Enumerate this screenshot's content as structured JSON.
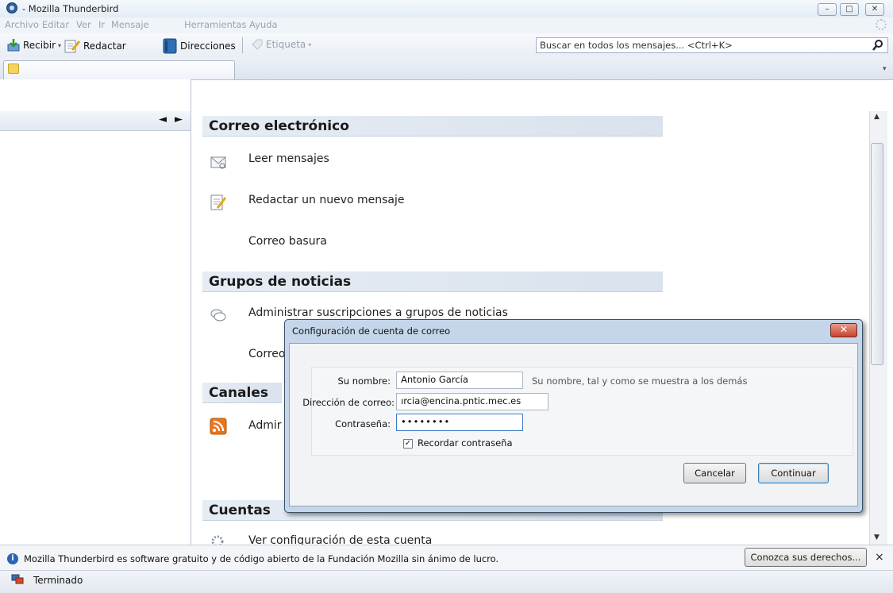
{
  "window": {
    "title": "- Mozilla Thunderbird"
  },
  "menu": {
    "items": [
      "Archivo",
      "Editar",
      "Ver",
      "Ir",
      "Mensaje",
      "Herramientas",
      "Ayuda"
    ]
  },
  "toolbar": {
    "get_label": "Recibir",
    "write_label": "Redactar",
    "address_label": "Direcciones",
    "tag_label": "Etiqueta"
  },
  "search": {
    "placeholder": "Buscar en todos los mensajes... <Ctrl+K>"
  },
  "main": {
    "sections": [
      {
        "title": "Correo electrónico",
        "items": [
          "Leer mensajes",
          "Redactar un nuevo mensaje",
          "Correo basura"
        ]
      },
      {
        "title": "Grupos de noticias",
        "items": [
          "Administrar suscripciones a grupos de noticias",
          "Correo"
        ]
      },
      {
        "title": "Canales",
        "items": [
          "Admir"
        ]
      },
      {
        "title": "Cuentas",
        "items": [
          "Ver configuración de esta cuenta"
        ]
      }
    ]
  },
  "dialog": {
    "title": "Configuración de cuenta de correo",
    "name_label": "Su nombre:",
    "name_value": "Antonio García",
    "name_hint": "Su nombre, tal y como se muestra a los demás",
    "email_label": "Dirección de correo:",
    "email_value": "ırcia@encina.pntic.mec.es",
    "password_label": "Contraseña:",
    "password_value": "••••••••",
    "remember_label": "Recordar contraseña",
    "remember_checked": true,
    "cancel_label": "Cancelar",
    "continue_label": "Continuar"
  },
  "notification": {
    "text": "Mozilla Thunderbird es software gratuito y de código abierto de la Fundación Mozilla sin ánimo de lucro.",
    "button_label": "Conozca sus derechos...",
    "close_glyph": "×"
  },
  "status": {
    "text": "Terminado"
  }
}
